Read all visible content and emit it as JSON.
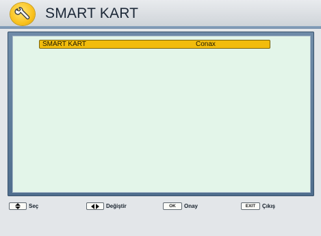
{
  "header": {
    "title": "SMART KART",
    "icon": "wrench-icon",
    "accent_color": "#f7c01c"
  },
  "menu": {
    "items": [
      {
        "label": "SMART KART",
        "value": "Conax",
        "selected": true
      }
    ],
    "highlight_color": "#f2bc0c",
    "background_color": "#e3f5e9"
  },
  "footer": {
    "select": {
      "key_icon": "up-down-arrows-icon",
      "label": "Seç"
    },
    "change": {
      "key_icon": "left-right-arrows-icon",
      "label": "Değiştir"
    },
    "ok": {
      "key": "OK",
      "label": "Onay"
    },
    "exit": {
      "key": "EXIT",
      "label": "Çıkış"
    }
  }
}
